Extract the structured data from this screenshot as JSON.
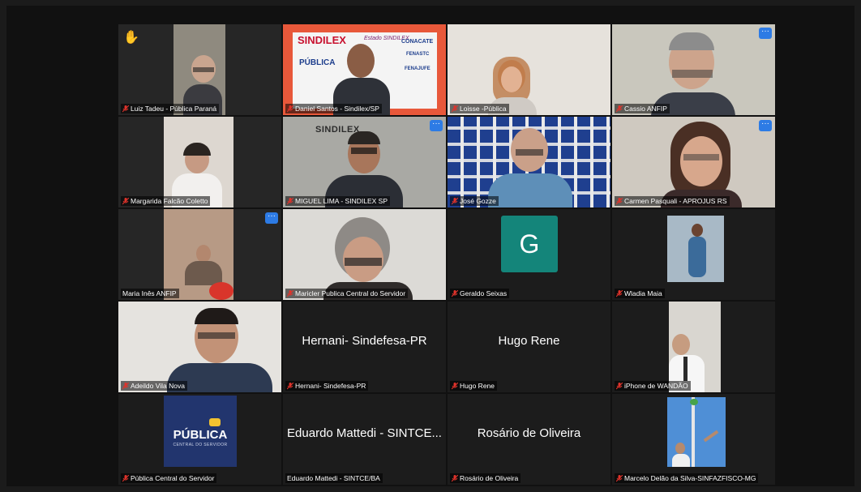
{
  "meeting": {
    "tiles": [
      {
        "name": "Luiz Tadeu - Pública Paraná",
        "muted": true,
        "hand_raised": true
      },
      {
        "name": "Daniel Santos - Sindilex/SP",
        "muted": true,
        "banner": {
          "brand": "SINDILEX",
          "estado": "Estado SINDILEX",
          "publica": "PÚBLICA",
          "conacate": "CONACATE",
          "fenastc": "FENASTC",
          "fenajufe": "FENAJUFE"
        }
      },
      {
        "name": "Loisse -Pública",
        "muted": true
      },
      {
        "name": "Cassio ANFIP",
        "muted": true,
        "more_button": true
      },
      {
        "name": "Margarida Falcão Coletto",
        "muted": true
      },
      {
        "name": "MIGUEL LIMA - SINDILEX SP",
        "muted": true,
        "more_button": true,
        "wall_logo": "SINDILEX"
      },
      {
        "name": "José Gozze",
        "muted": true
      },
      {
        "name": "Carmen Pasquali - APROJUS RS",
        "muted": true,
        "more_button": true,
        "active_speaker": true
      },
      {
        "name": "Maria Inês ANFIP",
        "muted": false,
        "more_button": true
      },
      {
        "name": "Maricler Publica Central do Servidor",
        "muted": true
      },
      {
        "name": "Geraldo Seixas",
        "muted": true,
        "avatar_letter": "G"
      },
      {
        "name": "Wladia Maia",
        "muted": true
      },
      {
        "name": "Adeildo Vila Nova",
        "muted": true
      },
      {
        "name": "Hernani- Sindefesa-PR",
        "muted": true,
        "center_name": "Hernani- Sindefesa-PR"
      },
      {
        "name": "Hugo Rene",
        "muted": true,
        "center_name": "Hugo Rene"
      },
      {
        "name": "iPhone de WANDÃO",
        "muted": true
      },
      {
        "name": "Pública Central do Servidor",
        "muted": true,
        "logo": {
          "main": "PÚBLICA",
          "sub": "CENTRAL DO SERVIDOR"
        }
      },
      {
        "name": "Eduardo Mattedi - SINTCE/BA",
        "muted": false,
        "center_name": "Eduardo Mattedi - SINTCE..."
      },
      {
        "name": "Rosário de Oliveira",
        "muted": true,
        "center_name": "Rosário de Oliveira"
      },
      {
        "name": "Marcelo Delão da Silva-SINFAZFISCO-MG",
        "muted": true
      }
    ]
  },
  "icons": {
    "mic_muted": "mic-muted-icon",
    "more": "more-options-icon",
    "hand": "raised-hand-icon"
  },
  "colors": {
    "stage_background": "#111111",
    "muted_icon": "#e0332b",
    "active_speaker_border": "#3fbf4f",
    "more_button": "#2d7be5",
    "avatar_g": "#14857a",
    "hand": "#f5b82e"
  },
  "symbols": {
    "more": "···",
    "hand": "✋"
  }
}
